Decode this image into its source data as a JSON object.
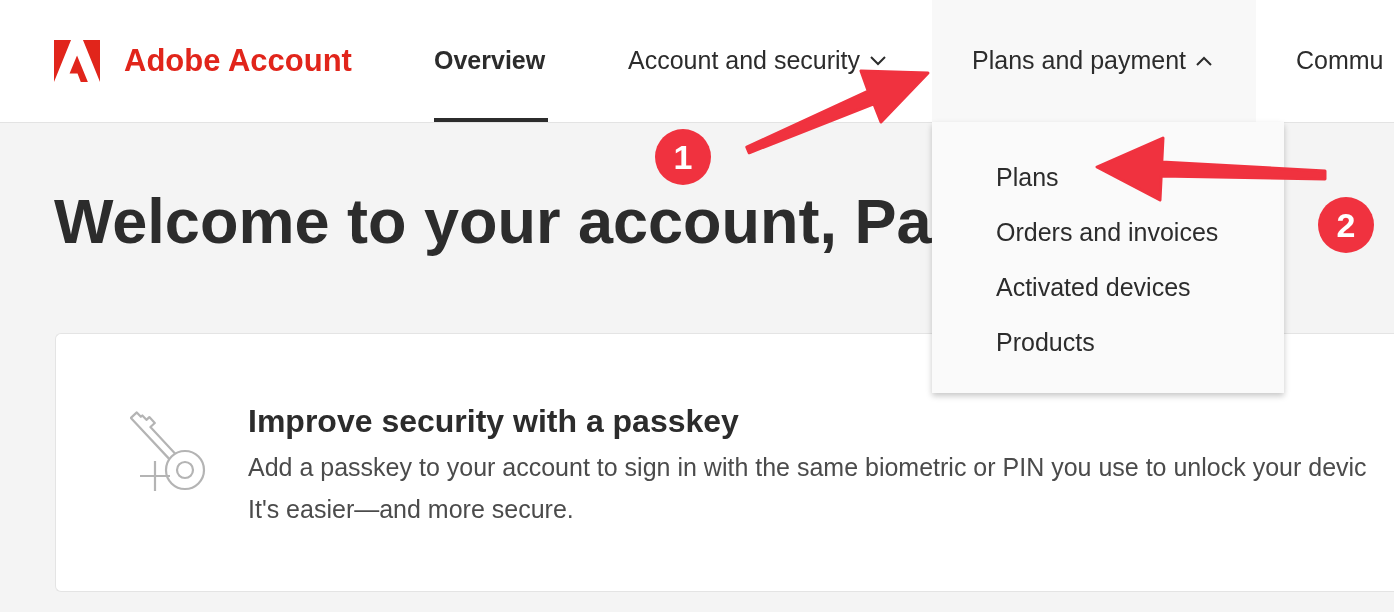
{
  "header": {
    "brand": "Adobe Account",
    "nav": [
      {
        "label": "Overview",
        "kind": "link",
        "selected": true
      },
      {
        "label": "Account and security",
        "kind": "dropdown",
        "selected": false,
        "expanded": false
      },
      {
        "label": "Plans and payment",
        "kind": "dropdown",
        "selected": false,
        "expanded": true,
        "menu_items": [
          "Plans",
          "Orders and invoices",
          "Activated devices",
          "Products"
        ]
      },
      {
        "label": "Commu",
        "kind": "link",
        "selected": false
      }
    ]
  },
  "heading": "Welcome to your account, Pa",
  "passkey_card": {
    "title": "Improve security with a passkey",
    "description_lines": [
      "Add a passkey to your account to sign in with the same biometric or PIN you use to unlock your devic",
      "It's easier—and more secure."
    ]
  },
  "callouts": [
    {
      "label": "1"
    },
    {
      "label": "2"
    }
  ]
}
